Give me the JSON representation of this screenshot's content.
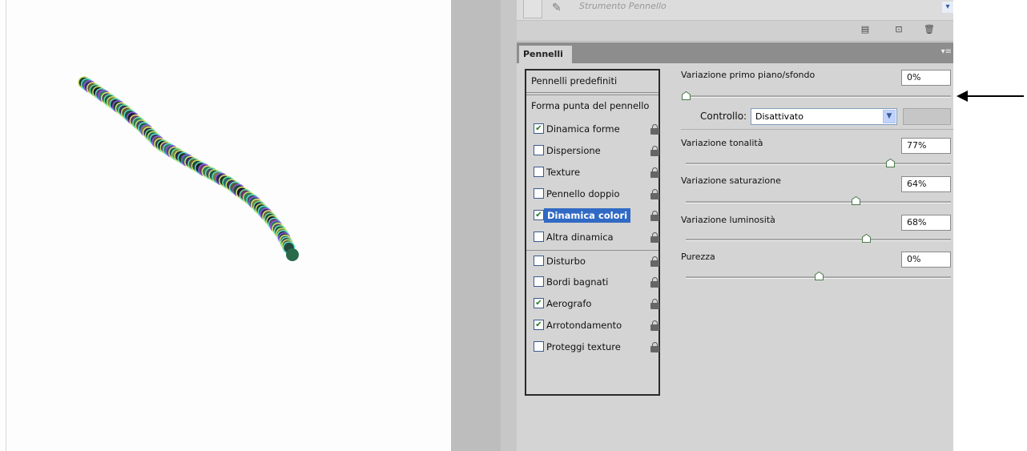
{
  "toolbar": {
    "tool_label": "Strumento Pennello"
  },
  "panel": {
    "tab_label": "Pennelli"
  },
  "brush_list": [
    {
      "label": "Pennelli predefiniti",
      "checkbox": null,
      "checked": false,
      "selected": false,
      "lock": false
    },
    {
      "label": "Forma punta del pennello",
      "checkbox": null,
      "checked": false,
      "selected": false,
      "lock": false
    },
    {
      "label": "Dinamica forme",
      "checkbox": true,
      "checked": true,
      "selected": false,
      "lock": true
    },
    {
      "label": "Dispersione",
      "checkbox": true,
      "checked": false,
      "selected": false,
      "lock": true
    },
    {
      "label": "Texture",
      "checkbox": true,
      "checked": false,
      "selected": false,
      "lock": true
    },
    {
      "label": "Pennello doppio",
      "checkbox": true,
      "checked": false,
      "selected": false,
      "lock": true
    },
    {
      "label": "Dinamica colori",
      "checkbox": true,
      "checked": true,
      "selected": true,
      "lock": true
    },
    {
      "label": "Altra dinamica",
      "checkbox": true,
      "checked": false,
      "selected": false,
      "lock": true
    },
    {
      "label": "Disturbo",
      "checkbox": true,
      "checked": false,
      "selected": false,
      "lock": true
    },
    {
      "label": "Bordi bagnati",
      "checkbox": true,
      "checked": false,
      "selected": false,
      "lock": true
    },
    {
      "label": "Aerografo",
      "checkbox": true,
      "checked": true,
      "selected": false,
      "lock": true
    },
    {
      "label": "Arrotondamento",
      "checkbox": true,
      "checked": true,
      "selected": false,
      "lock": true
    },
    {
      "label": "Proteggi texture",
      "checkbox": true,
      "checked": false,
      "selected": false,
      "lock": true
    }
  ],
  "settings": {
    "fg_bg": {
      "label": "Variazione primo piano/sfondo",
      "value": "0%",
      "level": 0.0
    },
    "control": {
      "label": "Controllo:",
      "value": "Disattivato"
    },
    "hue": {
      "label": "Variazione tonalità",
      "value": "77%",
      "level": 0.77
    },
    "saturation": {
      "label": "Variazione saturazione",
      "value": "64%",
      "level": 0.64
    },
    "brightness": {
      "label": "Variazione luminosità",
      "value": "68%",
      "level": 0.68
    },
    "purity": {
      "label": "Purezza",
      "value": "0%",
      "level": 0.5
    }
  },
  "colors": {
    "selected": "#316ac5",
    "checkmark": "#1e7a1e",
    "arrow": "#000000"
  }
}
